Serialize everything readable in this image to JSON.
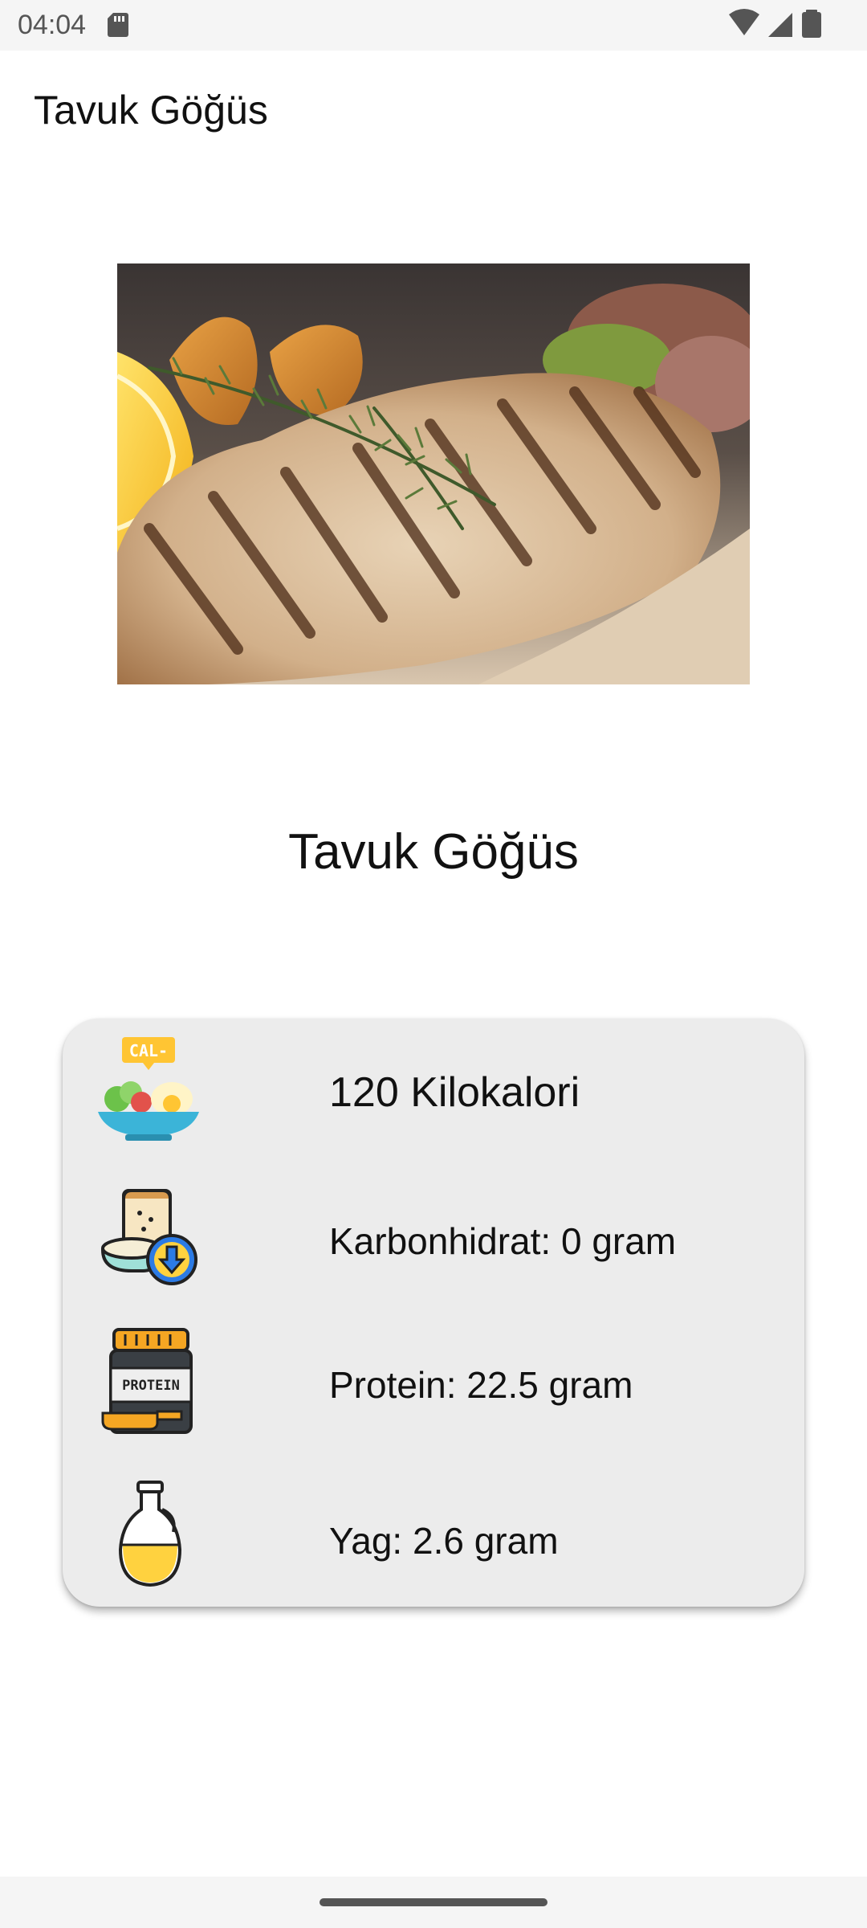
{
  "status_bar": {
    "time": "04:04",
    "icons": [
      "sd-card-icon",
      "wifi-icon",
      "signal-icon",
      "battery-icon"
    ]
  },
  "app_bar": {
    "title": "Tavuk Göğüs"
  },
  "food": {
    "name": "Tavuk Göğüs",
    "photo_icon": "grilled-chicken-breast-photo"
  },
  "nutrition": {
    "calories": {
      "icon": "calorie-meal-icon",
      "badge": "CAL-",
      "label": "120 Kilokalori"
    },
    "carbs": {
      "icon": "carbohydrate-down-icon",
      "label": "Karbonhidrat: 0 gram"
    },
    "protein": {
      "icon": "protein-jar-icon",
      "jar_text": "PROTEIN",
      "label": "Protein: 22.5 gram"
    },
    "fat": {
      "icon": "oil-bottle-icon",
      "label": "Yag: 2.6 gram"
    }
  },
  "colors": {
    "card_background": "#ececec",
    "status_bar": "#f5f5f5",
    "text": "#111111"
  }
}
